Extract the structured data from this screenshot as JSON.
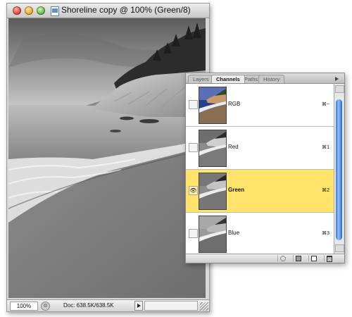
{
  "document_window": {
    "title": "Shoreline copy @ 100% (Green/8)",
    "zoom": "100%",
    "doc_size": "Doc: 638.5K/638.5K"
  },
  "channels_panel": {
    "tabs": [
      {
        "label": "Layers",
        "active": false
      },
      {
        "label": "Channels",
        "active": true
      },
      {
        "label": "Paths",
        "active": false
      },
      {
        "label": "History",
        "active": false
      }
    ],
    "channels": [
      {
        "name": "RGB",
        "shortcut": "⌘~",
        "visible": false,
        "selected": false,
        "thumb": "color"
      },
      {
        "name": "Red",
        "shortcut": "⌘1",
        "visible": false,
        "selected": false,
        "thumb": "gray"
      },
      {
        "name": "Green",
        "shortcut": "⌘2",
        "visible": true,
        "selected": true,
        "thumb": "gray"
      },
      {
        "name": "Blue",
        "shortcut": "⌘3",
        "visible": false,
        "selected": false,
        "thumb": "gray"
      }
    ],
    "footer_icons": [
      "load-channel-as-selection-icon",
      "save-selection-as-channel-icon",
      "new-channel-icon",
      "delete-channel-icon"
    ]
  },
  "colors": {
    "selected_row": "#ffe36a",
    "scroll_thumb": "#3a79d8"
  }
}
